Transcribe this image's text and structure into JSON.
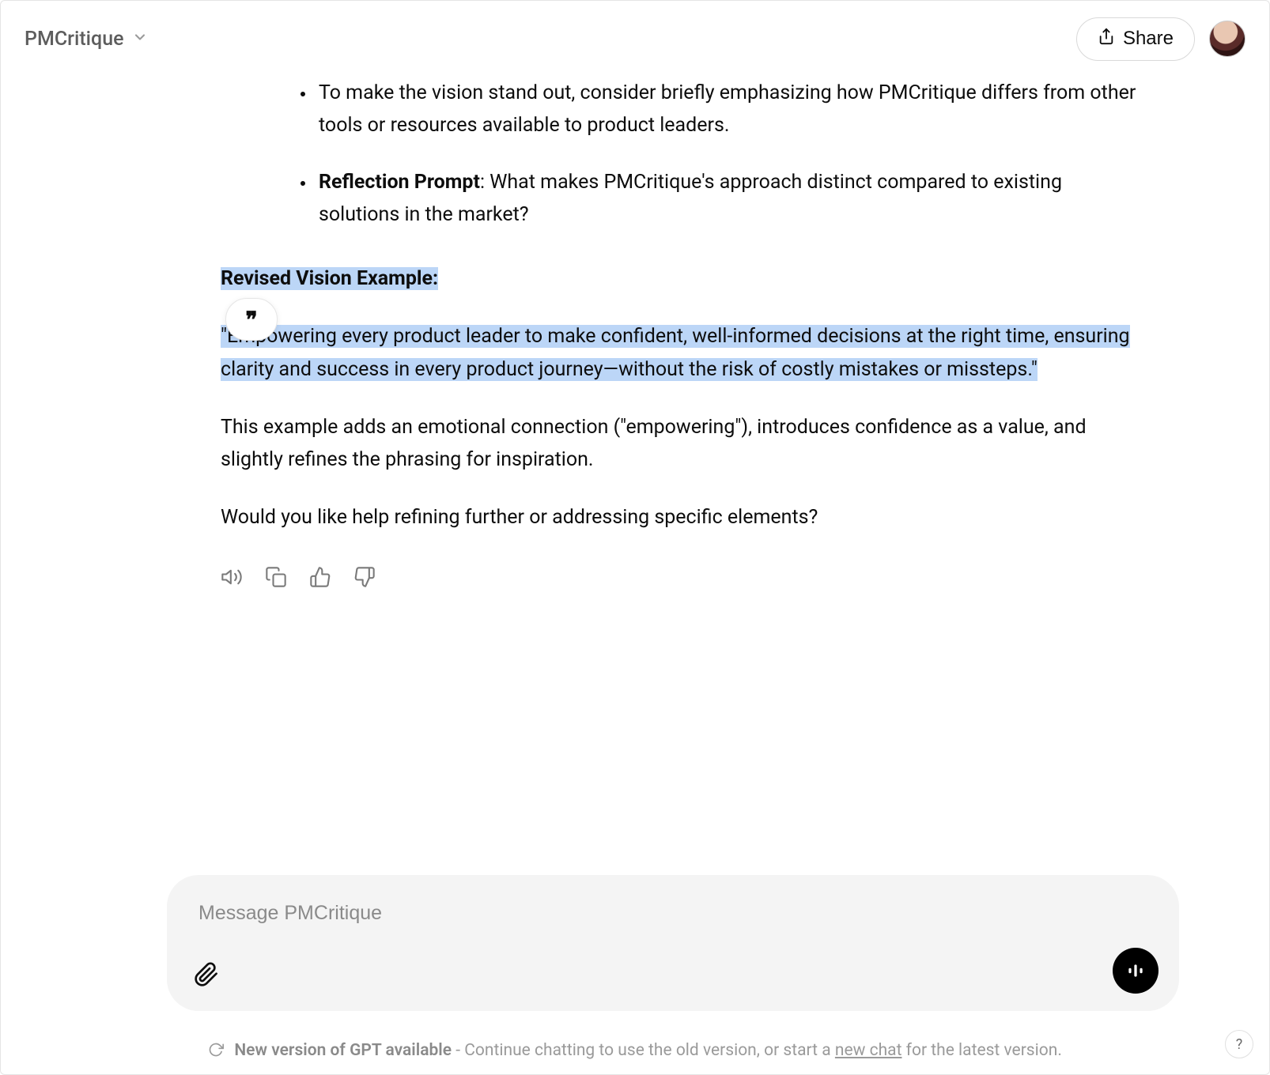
{
  "header": {
    "title": "PMCritique",
    "share_label": "Share"
  },
  "message": {
    "bullets": [
      {
        "text": "To make the vision stand out, consider briefly emphasizing how PMCritique differs from other tools or resources available to product leaders."
      },
      {
        "prefix": "Reflection Prompt",
        "text": ": What makes PMCritique's approach distinct compared to existing solutions in the market?"
      }
    ],
    "heading": "Revised Vision Example:",
    "quote": "\"Empowering every product leader to make confident, well-informed decisions at the right time, ensuring clarity and success in every product journey—without the risk of costly mistakes or missteps.\"",
    "explain": "This example adds an emotional connection (\"empowering\"), introduces confidence as a value, and slightly refines the phrasing for inspiration.",
    "followup": "Would you like help refining further or addressing specific elements?"
  },
  "composer": {
    "placeholder": "Message PMCritique"
  },
  "footer": {
    "bold": "New version of GPT available",
    "mid": " - Continue chatting to use the old version, or start a ",
    "link": "new chat",
    "tail": " for the latest version."
  },
  "help": "?"
}
